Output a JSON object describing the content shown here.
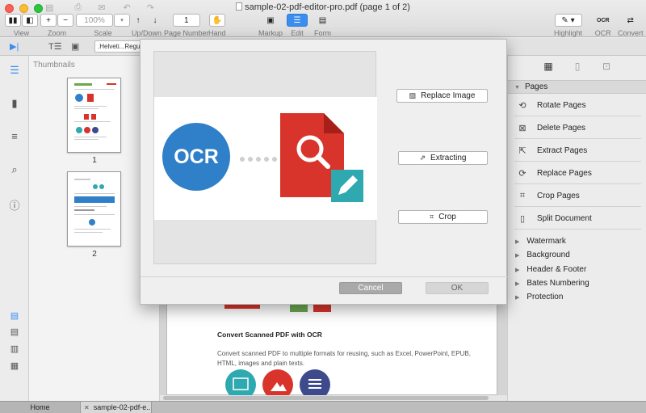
{
  "window": {
    "title": "sample-02-pdf-editor-pro.pdf (page 1 of 2)"
  },
  "toolbar": {
    "view_label": "View",
    "zoom_label": "Zoom",
    "zoom_value": "100%",
    "scale_label": "Scale",
    "updown_label": "Up/Down",
    "page_number_value": "1",
    "page_number_label": "Page Number",
    "hand_label": "Hand",
    "markup_label": "Markup",
    "edit_label": "Edit",
    "form_label": "Form",
    "highlight_label": "Highlight",
    "ocr_label": "OCR",
    "ocr_icon_text": "OCR",
    "convert_label": "Convert"
  },
  "strip": {
    "font_value": ".Helveti...Regula"
  },
  "thumbnails": {
    "title": "Thumbnails",
    "pages": [
      "1",
      "2"
    ]
  },
  "document": {
    "heading": "Convert Scanned PDF with OCR",
    "body": "Convert scanned PDF to multiple formats for reusing, such as Excel, PowerPoint, EPUB, HTML, images and plain texts."
  },
  "dialog": {
    "preview_text": "OCR",
    "replace_image_label": "Replace Image",
    "extracting_label": "Extracting",
    "crop_label": "Crop",
    "cancel_label": "Cancel",
    "ok_label": "OK"
  },
  "right_panel": {
    "section_title": "Pages",
    "items": [
      {
        "label": "Rotate Pages",
        "icon": "rotate-icon"
      },
      {
        "label": "Delete Pages",
        "icon": "delete-page-icon"
      },
      {
        "label": "Extract Pages",
        "icon": "extract-page-icon"
      },
      {
        "label": "Replace Pages",
        "icon": "replace-page-icon"
      },
      {
        "label": "Crop Pages",
        "icon": "crop-icon"
      },
      {
        "label": "Split Document",
        "icon": "split-icon"
      }
    ],
    "collapsed": [
      "Watermark",
      "Background",
      "Header & Footer",
      "Bates Numbering",
      "Protection"
    ]
  },
  "tabs": {
    "home": "Home",
    "doc": "sample-02-pdf-e..."
  },
  "colors": {
    "accent": "#3b8df0",
    "ocr_blue": "#2f80c8",
    "pdf_red": "#d9342b",
    "edit_teal": "#2fa9b0"
  }
}
